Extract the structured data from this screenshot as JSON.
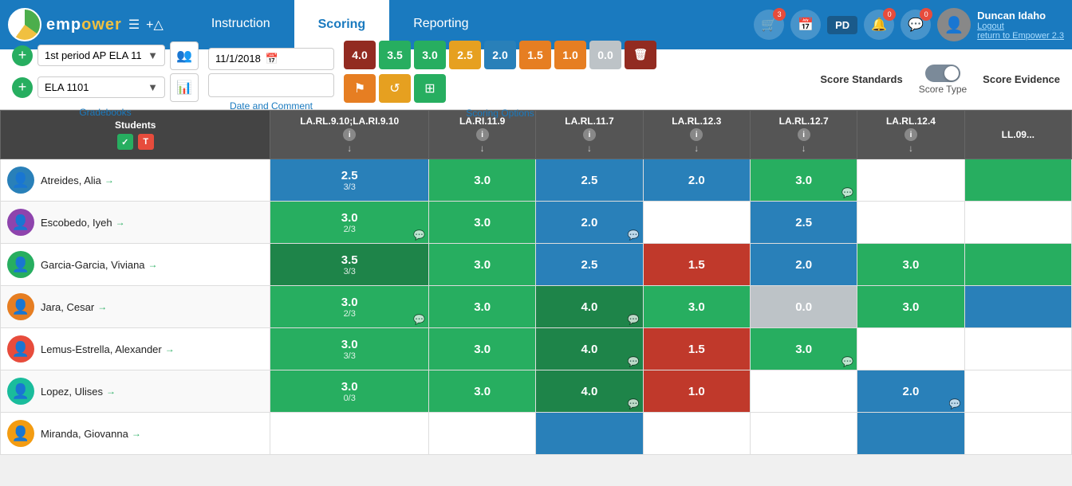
{
  "header": {
    "logo_text": "emp",
    "logo_highlight": "ower",
    "nav_tabs": [
      {
        "id": "instruction",
        "label": "Instruction",
        "active": false
      },
      {
        "id": "scoring",
        "label": "Scoring",
        "active": true
      },
      {
        "id": "reporting",
        "label": "Reporting",
        "active": false
      }
    ],
    "user": {
      "name": "Duncan Idaho",
      "logout": "Logout",
      "return_link": "return to Empower 2.3"
    },
    "cart_count": "3",
    "notif_count_1": "0",
    "notif_count_2": "0",
    "pd_label": "PD"
  },
  "toolbar": {
    "gradebook_label": "1st period AP ELA 11",
    "class_label": "ELA 1101",
    "gradebooks_link": "Gradebooks",
    "date": "11/1/2018",
    "date_comment_label": "Date and Comment",
    "score_values": [
      "4.0",
      "3.5",
      "3.0",
      "2.5",
      "2.0",
      "1.5",
      "1.0",
      "0.0"
    ],
    "scoring_options_label": "Scoring Options",
    "score_standards_label": "Score Standards",
    "score_evidence_label": "Score Evidence",
    "score_type_label": "Score Type"
  },
  "table": {
    "students_header": "Students",
    "columns": [
      {
        "id": "la_rl_9_10",
        "label": "LA.RL.9.10;LA.RI.9.10"
      },
      {
        "id": "la_ri_11_9",
        "label": "LA.RI.11.9"
      },
      {
        "id": "la_rl_11_7",
        "label": "LA.RL.11.7"
      },
      {
        "id": "la_rl_12_3",
        "label": "LA.RL.12.3"
      },
      {
        "id": "la_rl_12_7",
        "label": "LA.RL.12.7"
      },
      {
        "id": "la_rl_12_4",
        "label": "LA.RL.12.4"
      },
      {
        "id": "ll_09",
        "label": "LL.09..."
      }
    ],
    "rows": [
      {
        "name": "Atreides, Alia",
        "avatar": "👤",
        "scores": [
          {
            "val": "2.5",
            "sub": "3/3",
            "color": "cell-blue"
          },
          {
            "val": "3.0",
            "sub": "",
            "color": "cell-green"
          },
          {
            "val": "2.5",
            "sub": "",
            "color": "cell-blue"
          },
          {
            "val": "2.0",
            "sub": "",
            "color": "cell-blue"
          },
          {
            "val": "3.0",
            "sub": "",
            "color": "cell-green",
            "comment": true
          },
          {
            "val": "",
            "sub": "",
            "color": "cell-white"
          },
          {
            "val": "",
            "sub": "",
            "color": "cell-green"
          }
        ]
      },
      {
        "name": "Escobedo, Iyeh",
        "avatar": "👤",
        "scores": [
          {
            "val": "3.0",
            "sub": "2/3",
            "color": "cell-green",
            "comment": true
          },
          {
            "val": "3.0",
            "sub": "",
            "color": "cell-green"
          },
          {
            "val": "2.0",
            "sub": "",
            "color": "cell-blue",
            "comment": true
          },
          {
            "val": "",
            "sub": "",
            "color": "cell-white"
          },
          {
            "val": "2.5",
            "sub": "",
            "color": "cell-blue"
          },
          {
            "val": "",
            "sub": "",
            "color": "cell-white"
          },
          {
            "val": "",
            "sub": "",
            "color": "cell-white"
          }
        ]
      },
      {
        "name": "Garcia-Garcia, Viviana",
        "avatar": "👤",
        "scores": [
          {
            "val": "3.5",
            "sub": "3/3",
            "color": "cell-dark-green"
          },
          {
            "val": "3.0",
            "sub": "",
            "color": "cell-green"
          },
          {
            "val": "2.5",
            "sub": "",
            "color": "cell-blue"
          },
          {
            "val": "1.5",
            "sub": "",
            "color": "cell-red"
          },
          {
            "val": "2.0",
            "sub": "",
            "color": "cell-blue"
          },
          {
            "val": "3.0",
            "sub": "",
            "color": "cell-green"
          },
          {
            "val": "",
            "sub": "",
            "color": "cell-green"
          }
        ]
      },
      {
        "name": "Jara, Cesar",
        "avatar": "👤",
        "scores": [
          {
            "val": "3.0",
            "sub": "2/3",
            "color": "cell-green",
            "comment": true
          },
          {
            "val": "3.0",
            "sub": "",
            "color": "cell-green"
          },
          {
            "val": "4.0",
            "sub": "",
            "color": "cell-dark-green",
            "comment": true
          },
          {
            "val": "3.0",
            "sub": "",
            "color": "cell-green"
          },
          {
            "val": "0.0",
            "sub": "",
            "color": "cell-gray"
          },
          {
            "val": "3.0",
            "sub": "",
            "color": "cell-green"
          },
          {
            "val": "",
            "sub": "",
            "color": "cell-blue"
          }
        ]
      },
      {
        "name": "Lemus-Estrella, Alexander",
        "avatar": "👤",
        "scores": [
          {
            "val": "3.0",
            "sub": "3/3",
            "color": "cell-green"
          },
          {
            "val": "3.0",
            "sub": "",
            "color": "cell-green"
          },
          {
            "val": "4.0",
            "sub": "",
            "color": "cell-dark-green",
            "comment": true
          },
          {
            "val": "1.5",
            "sub": "",
            "color": "cell-red"
          },
          {
            "val": "3.0",
            "sub": "",
            "color": "cell-green",
            "comment": true
          },
          {
            "val": "",
            "sub": "",
            "color": "cell-white"
          },
          {
            "val": "",
            "sub": "",
            "color": "cell-white"
          }
        ]
      },
      {
        "name": "Lopez, Ulises",
        "avatar": "👤",
        "scores": [
          {
            "val": "3.0",
            "sub": "0/3",
            "color": "cell-green"
          },
          {
            "val": "3.0",
            "sub": "",
            "color": "cell-green"
          },
          {
            "val": "4.0",
            "sub": "",
            "color": "cell-dark-green",
            "comment": true
          },
          {
            "val": "1.0",
            "sub": "",
            "color": "cell-red"
          },
          {
            "val": "",
            "sub": "",
            "color": "cell-white"
          },
          {
            "val": "2.0",
            "sub": "",
            "color": "cell-blue",
            "comment": true
          },
          {
            "val": "",
            "sub": "",
            "color": "cell-white"
          }
        ]
      },
      {
        "name": "Miranda, Giovanna",
        "avatar": "👤",
        "scores": [
          {
            "val": "",
            "sub": "",
            "color": "cell-white"
          },
          {
            "val": "",
            "sub": "",
            "color": "cell-white"
          },
          {
            "val": "",
            "sub": "",
            "color": "cell-blue"
          },
          {
            "val": "",
            "sub": "",
            "color": "cell-white"
          },
          {
            "val": "",
            "sub": "",
            "color": "cell-white"
          },
          {
            "val": "",
            "sub": "",
            "color": "cell-blue"
          },
          {
            "val": "",
            "sub": "",
            "color": "cell-white"
          }
        ]
      }
    ]
  }
}
